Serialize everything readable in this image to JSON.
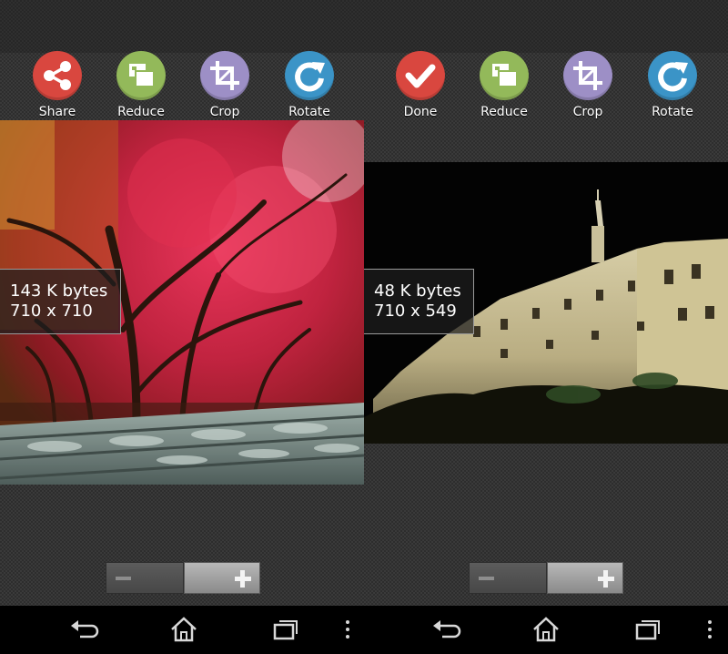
{
  "left_panel": {
    "toolbar": [
      {
        "label": "Share",
        "icon": "share-icon",
        "color": "#d9473f"
      },
      {
        "label": "Reduce",
        "icon": "reduce-icon",
        "color": "#93b95a"
      },
      {
        "label": "Crop",
        "icon": "crop-icon",
        "color": "#9d8fc6"
      },
      {
        "label": "Rotate",
        "icon": "rotate-icon",
        "color": "#3b94c7"
      }
    ],
    "image_info": {
      "size": "143 K bytes",
      "dimensions": "710 x 710"
    }
  },
  "right_panel": {
    "toolbar": [
      {
        "label": "Done",
        "icon": "check-icon",
        "color": "#d9473f"
      },
      {
        "label": "Reduce",
        "icon": "reduce-icon",
        "color": "#93b95a"
      },
      {
        "label": "Crop",
        "icon": "crop-icon",
        "color": "#9d8fc6"
      },
      {
        "label": "Rotate",
        "icon": "rotate-icon",
        "color": "#3b94c7"
      }
    ],
    "image_info": {
      "size": "48 K bytes",
      "dimensions": "710 x 549"
    }
  },
  "zoom_control": {
    "minus_icon": "minus-icon",
    "plus_icon": "plus-icon"
  },
  "navigation_bar": {
    "buttons": [
      "back-icon",
      "home-icon",
      "recent-apps-icon",
      "overflow-menu-icon"
    ]
  }
}
